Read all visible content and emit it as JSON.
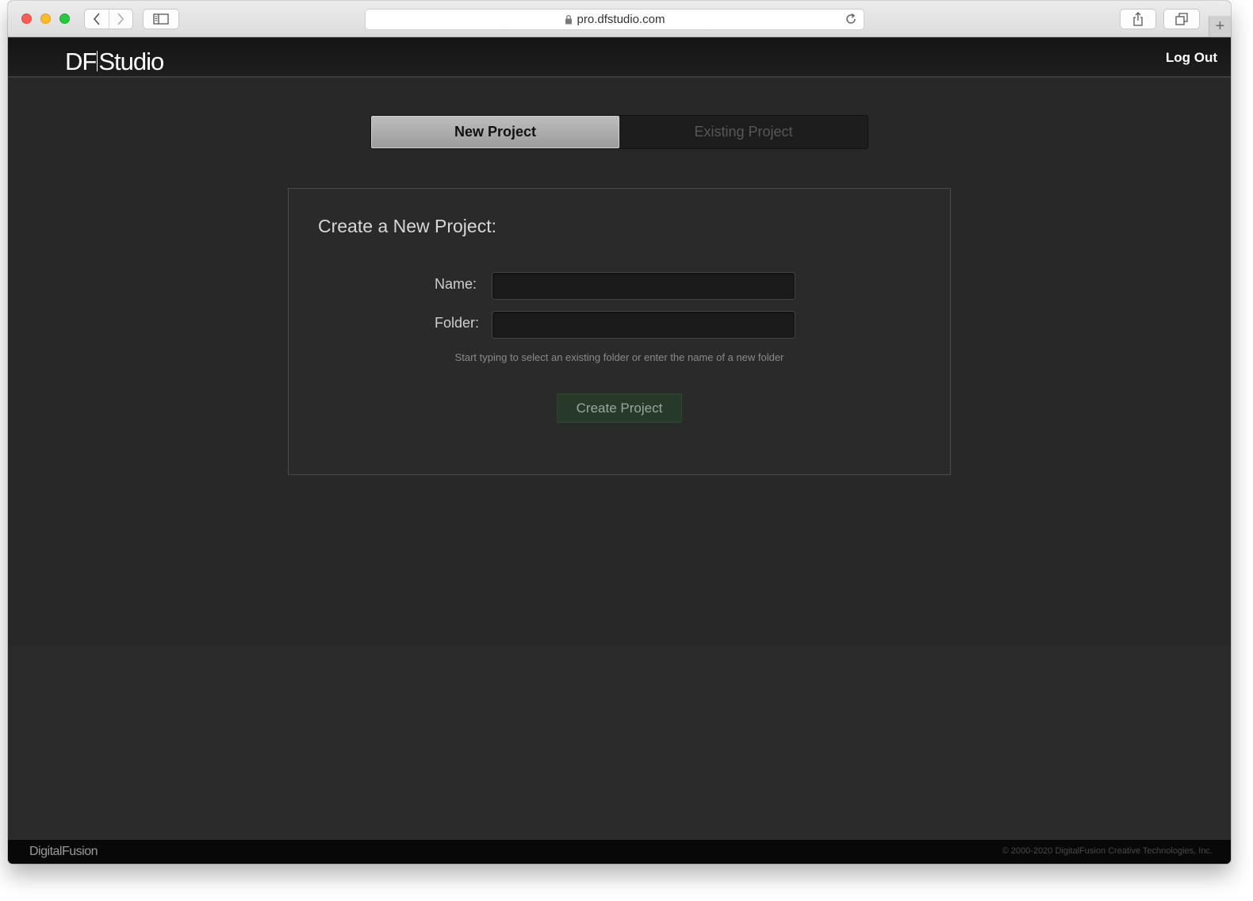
{
  "browser": {
    "url": "pro.dfstudio.com"
  },
  "header": {
    "logo": {
      "df": "DF",
      "studio": "Studio"
    },
    "logout_label": "Log Out"
  },
  "tabs": [
    {
      "label": "New Project",
      "active": true
    },
    {
      "label": "Existing Project",
      "active": false
    }
  ],
  "form": {
    "title": "Create a New Project:",
    "name_label": "Name:",
    "name_value": "",
    "folder_label": "Folder:",
    "folder_value": "",
    "hint": "Start typing to select an existing folder or enter the name of a new folder",
    "submit_label": "Create Project"
  },
  "footer": {
    "brand": "DigitalFusion",
    "copyright": "© 2000-2020 DigitalFusion Creative Technologies, Inc."
  },
  "colors": {
    "accent_button": "#273a29",
    "background": "#282828",
    "header": "#151515"
  }
}
